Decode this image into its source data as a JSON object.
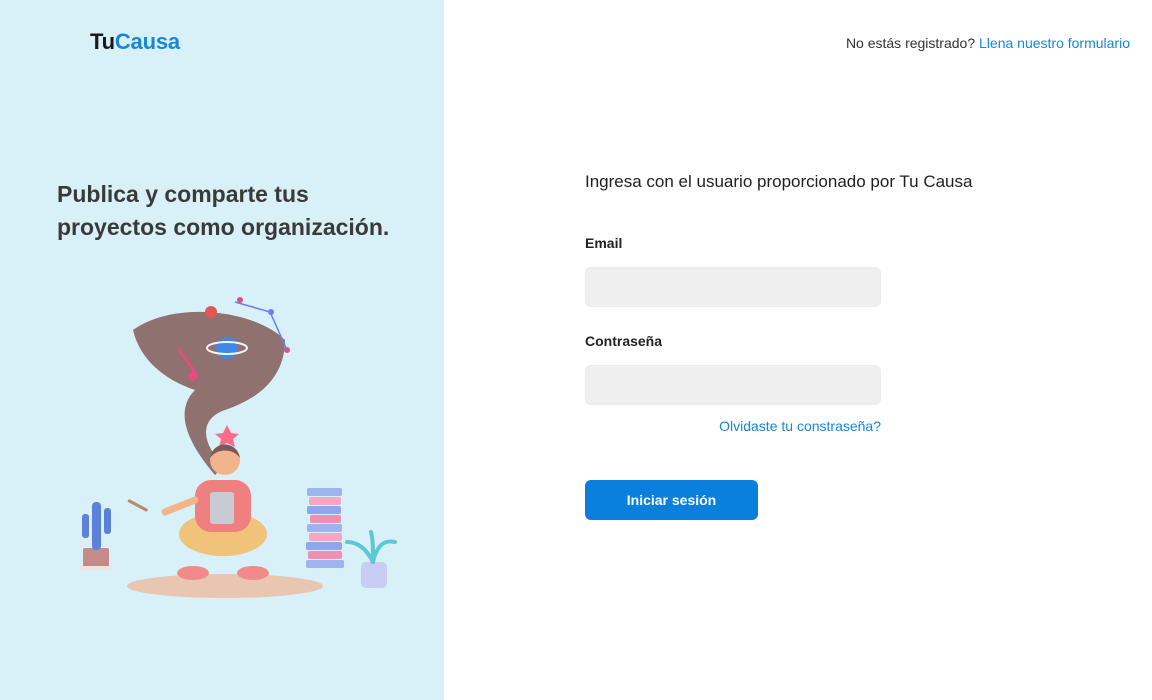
{
  "brand": {
    "part1": "Tu",
    "part2": "Causa"
  },
  "tagline": "Publica y comparte tus proyectos como organización.",
  "header": {
    "register_prompt": "No estás registrado?",
    "register_link": "Llena nuestro formulario"
  },
  "form": {
    "heading": "Ingresa con el usuario proporcionado por Tu Causa",
    "email_label": "Email",
    "email_value": "",
    "password_label": "Contraseña",
    "password_value": "",
    "forgot_link": "Olvidaste tu constraseña?",
    "submit_label": "Iniciar sesión"
  },
  "colors": {
    "left_panel_bg": "#d8f0f7",
    "brand_blue": "#1687d9",
    "button_blue": "#0a7fdb",
    "input_bg": "#efefef"
  }
}
